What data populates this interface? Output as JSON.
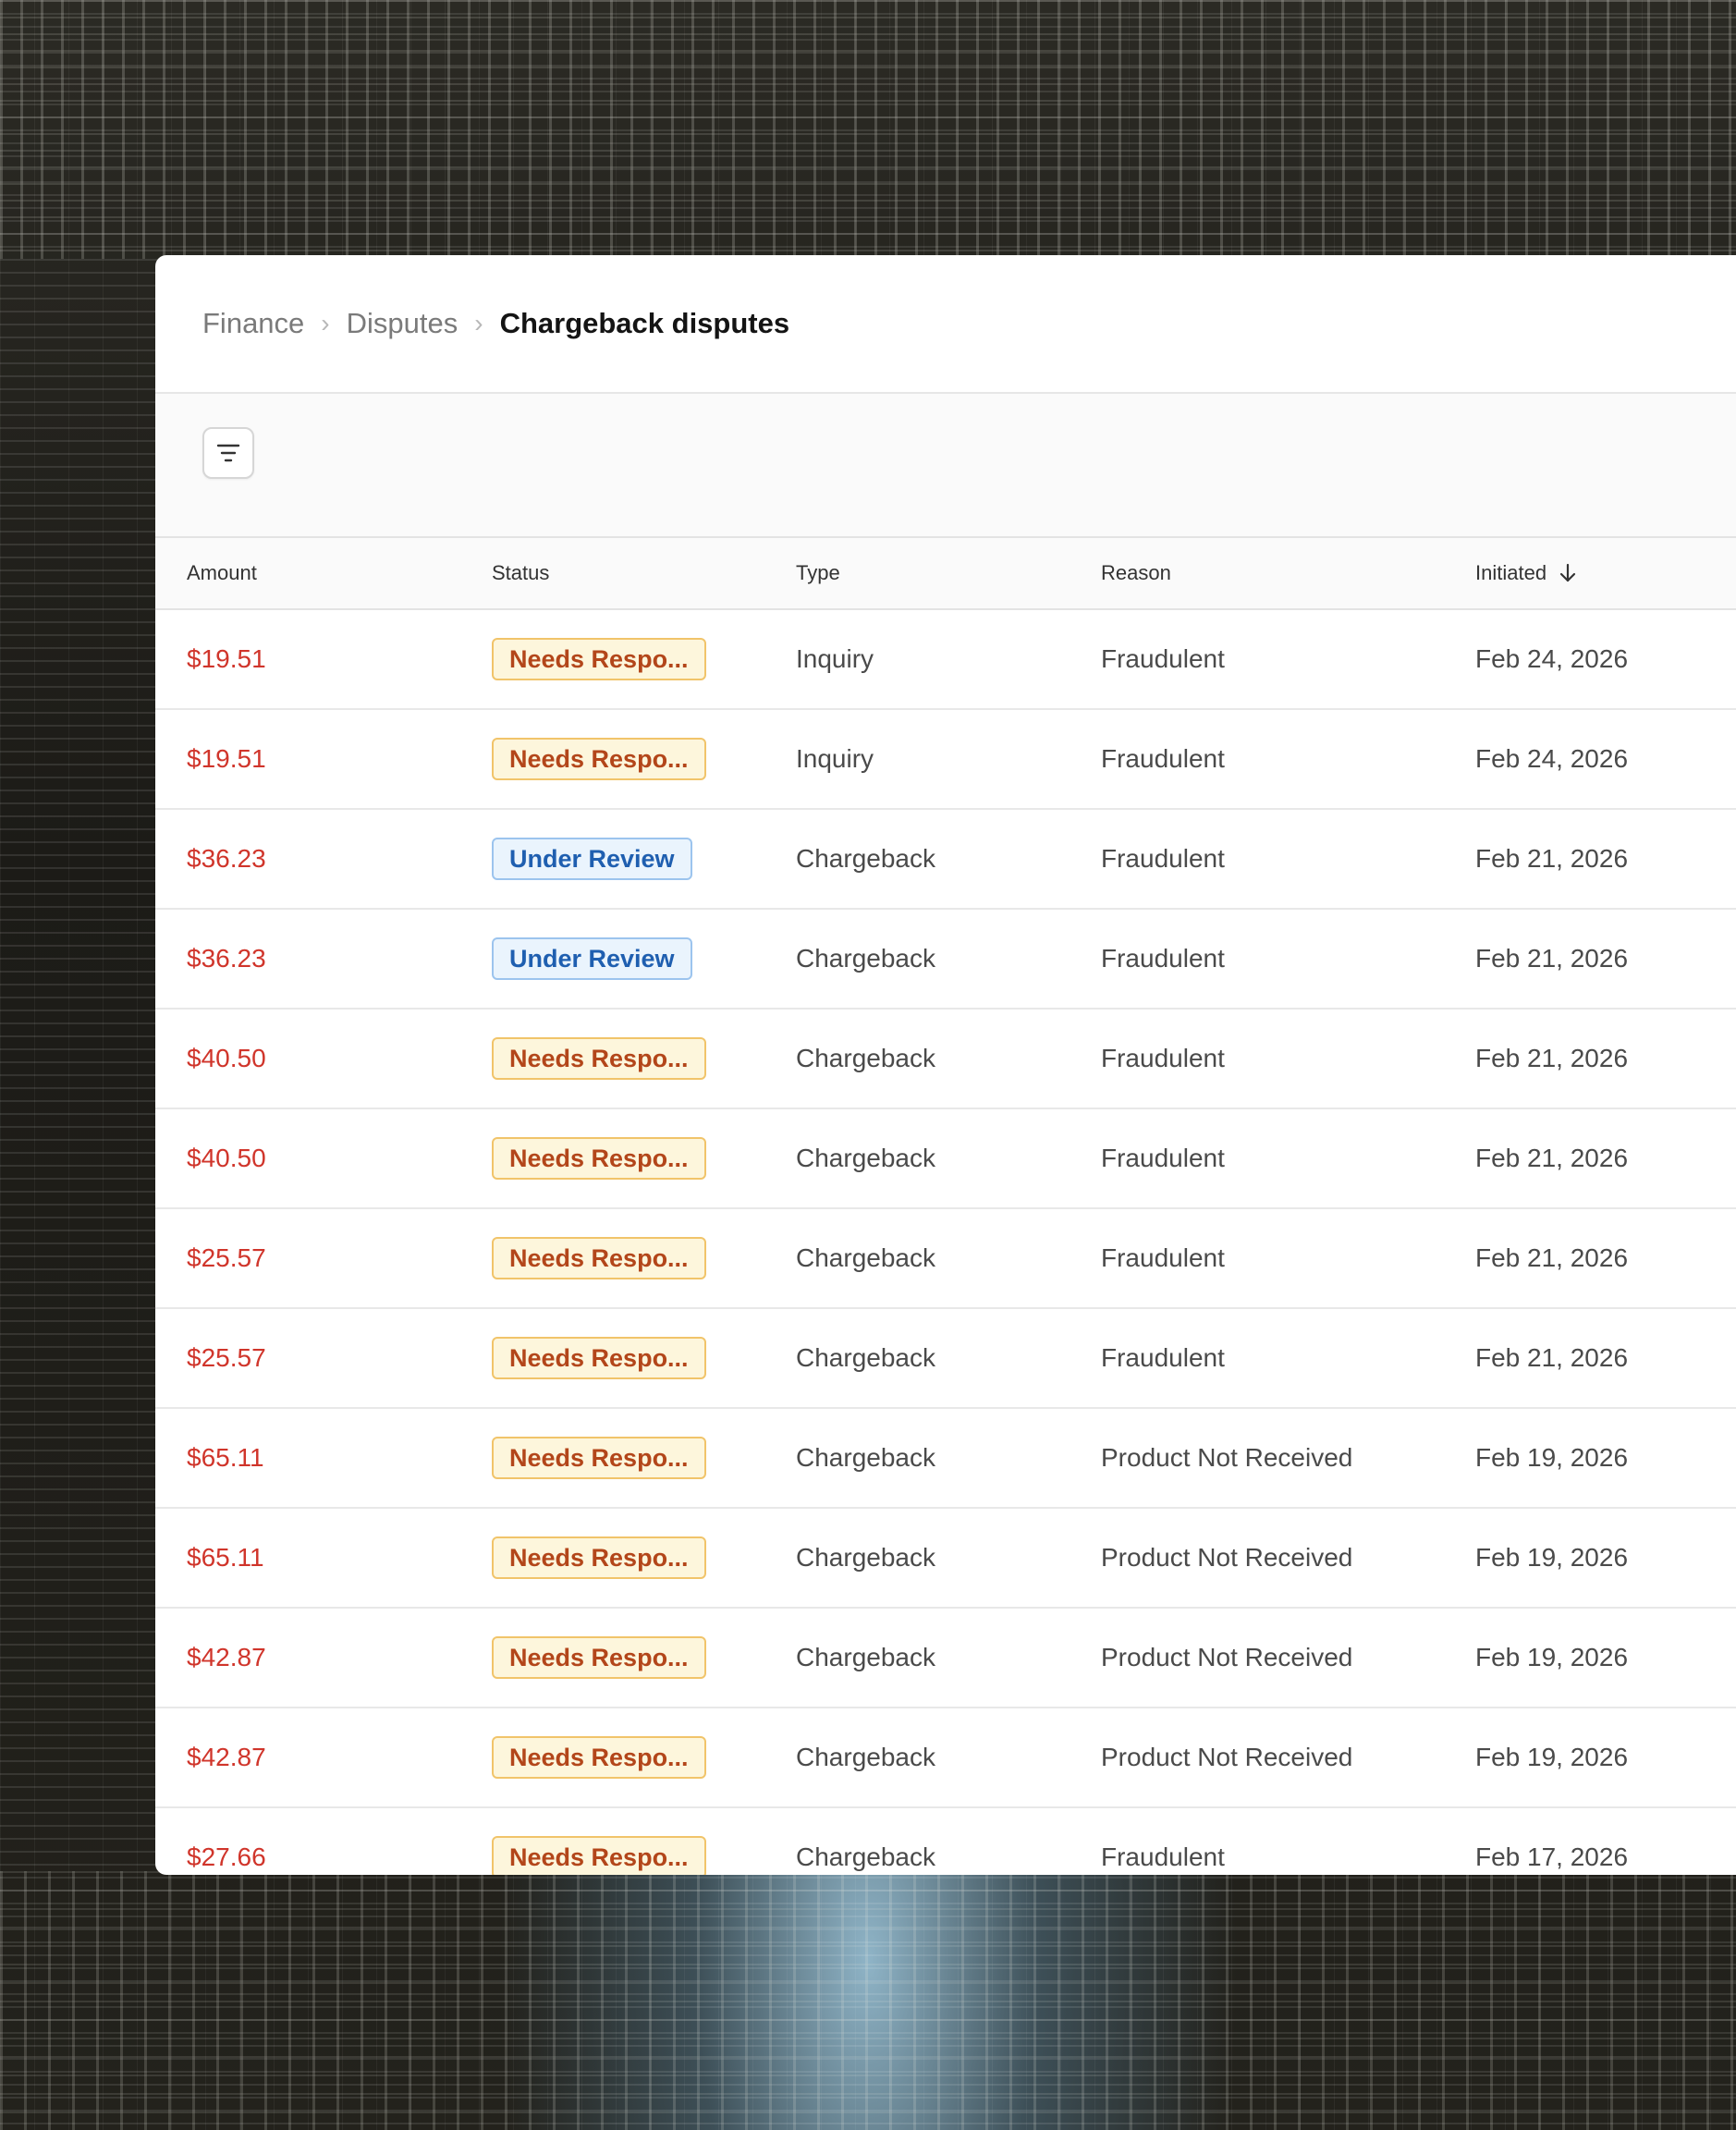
{
  "breadcrumb": {
    "items": [
      "Finance",
      "Disputes"
    ],
    "current": "Chargeback disputes"
  },
  "toolbar": {
    "filter_icon": "filter-icon"
  },
  "table": {
    "columns": {
      "amount": "Amount",
      "status": "Status",
      "type": "Type",
      "reason": "Reason",
      "initiated": "Initiated"
    },
    "sort": {
      "column": "initiated",
      "direction": "descending",
      "icon": "arrow-down-icon"
    },
    "rows": [
      {
        "amount": "$19.51",
        "status": "Needs Respo...",
        "status_kind": "warn",
        "type": "Inquiry",
        "reason": "Fraudulent",
        "initiated": "Feb 24, 2026"
      },
      {
        "amount": "$19.51",
        "status": "Needs Respo...",
        "status_kind": "warn",
        "type": "Inquiry",
        "reason": "Fraudulent",
        "initiated": "Feb 24, 2026"
      },
      {
        "amount": "$36.23",
        "status": "Under Review",
        "status_kind": "info",
        "type": "Chargeback",
        "reason": "Fraudulent",
        "initiated": "Feb 21, 2026"
      },
      {
        "amount": "$36.23",
        "status": "Under Review",
        "status_kind": "info",
        "type": "Chargeback",
        "reason": "Fraudulent",
        "initiated": "Feb 21, 2026"
      },
      {
        "amount": "$40.50",
        "status": "Needs Respo...",
        "status_kind": "warn",
        "type": "Chargeback",
        "reason": "Fraudulent",
        "initiated": "Feb 21, 2026"
      },
      {
        "amount": "$40.50",
        "status": "Needs Respo...",
        "status_kind": "warn",
        "type": "Chargeback",
        "reason": "Fraudulent",
        "initiated": "Feb 21, 2026"
      },
      {
        "amount": "$25.57",
        "status": "Needs Respo...",
        "status_kind": "warn",
        "type": "Chargeback",
        "reason": "Fraudulent",
        "initiated": "Feb 21, 2026"
      },
      {
        "amount": "$25.57",
        "status": "Needs Respo...",
        "status_kind": "warn",
        "type": "Chargeback",
        "reason": "Fraudulent",
        "initiated": "Feb 21, 2026"
      },
      {
        "amount": "$65.11",
        "status": "Needs Respo...",
        "status_kind": "warn",
        "type": "Chargeback",
        "reason": "Product Not Received",
        "initiated": "Feb 19, 2026"
      },
      {
        "amount": "$65.11",
        "status": "Needs Respo...",
        "status_kind": "warn",
        "type": "Chargeback",
        "reason": "Product Not Received",
        "initiated": "Feb 19, 2026"
      },
      {
        "amount": "$42.87",
        "status": "Needs Respo...",
        "status_kind": "warn",
        "type": "Chargeback",
        "reason": "Product Not Received",
        "initiated": "Feb 19, 2026"
      },
      {
        "amount": "$42.87",
        "status": "Needs Respo...",
        "status_kind": "warn",
        "type": "Chargeback",
        "reason": "Product Not Received",
        "initiated": "Feb 19, 2026"
      },
      {
        "amount": "$27.66",
        "status": "Needs Respo...",
        "status_kind": "warn",
        "type": "Chargeback",
        "reason": "Fraudulent",
        "initiated": "Feb 17, 2026"
      }
    ]
  },
  "colors": {
    "amount": "#d0352b",
    "warn_badge_text": "#b3461a",
    "warn_badge_bg": "#fdf6dc",
    "info_badge_text": "#1f5fb0",
    "info_badge_bg": "#eaf4fd"
  }
}
